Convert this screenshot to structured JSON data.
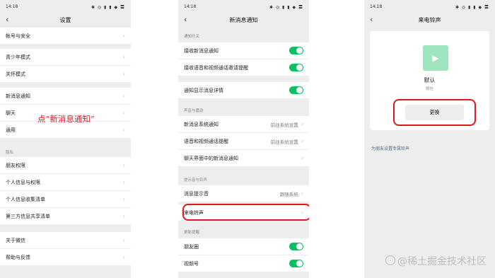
{
  "status": {
    "time": "14:18",
    "icons": "✱ ◎ ▮ ▮ ◆ 〓"
  },
  "phone1": {
    "title": "设置",
    "rows": [
      {
        "label": "帐号与安全"
      },
      {
        "label": "青少年模式"
      },
      {
        "label": "关怀模式"
      },
      {
        "label": "新消息通知"
      },
      {
        "label": "聊天"
      },
      {
        "label": "通用"
      },
      {
        "label": "朋友权限"
      },
      {
        "label": "个人信息与权限"
      },
      {
        "label": "个人信息收集清单"
      },
      {
        "label": "第三方信息共享清单"
      },
      {
        "label": "关于微信"
      },
      {
        "label": "帮助与反馈"
      }
    ],
    "section_privacy": "隐私",
    "annotation": "点“新消息通知”"
  },
  "phone2": {
    "title": "新消息通知",
    "sections": {
      "switch": "通知开关",
      "sound": "声音与震动",
      "tone": "提示音与铃声",
      "updates": "更新提醒"
    },
    "rows": [
      {
        "label": "接收新消息通知",
        "toggle": true
      },
      {
        "label": "接收语音和视频通话邀请提醒",
        "toggle": true
      },
      {
        "label": "通知显示消息详情",
        "toggle": true
      },
      {
        "label": "新消息系统通知",
        "value": "前往系统设置"
      },
      {
        "label": "语音和视频通话提醒",
        "value": "前往系统设置"
      },
      {
        "label": "聊天界面中的新消息通知"
      },
      {
        "label": "消息提示音",
        "value": "跟随系统"
      },
      {
        "label": "来电铃声"
      },
      {
        "label": "朋友圈",
        "toggle": true
      },
      {
        "label": "视频号",
        "toggle": true
      }
    ]
  },
  "phone3": {
    "title": "来电铃声",
    "ringtone_name": "默认",
    "ringtone_sub": "微信",
    "change_button": "更换",
    "friend_link": "为朋友设置专属铃声"
  },
  "watermark": "@稀土掘金技术社区",
  "colors": {
    "accent": "#07c160",
    "highlight": "#e0161c",
    "link": "#576b95"
  }
}
